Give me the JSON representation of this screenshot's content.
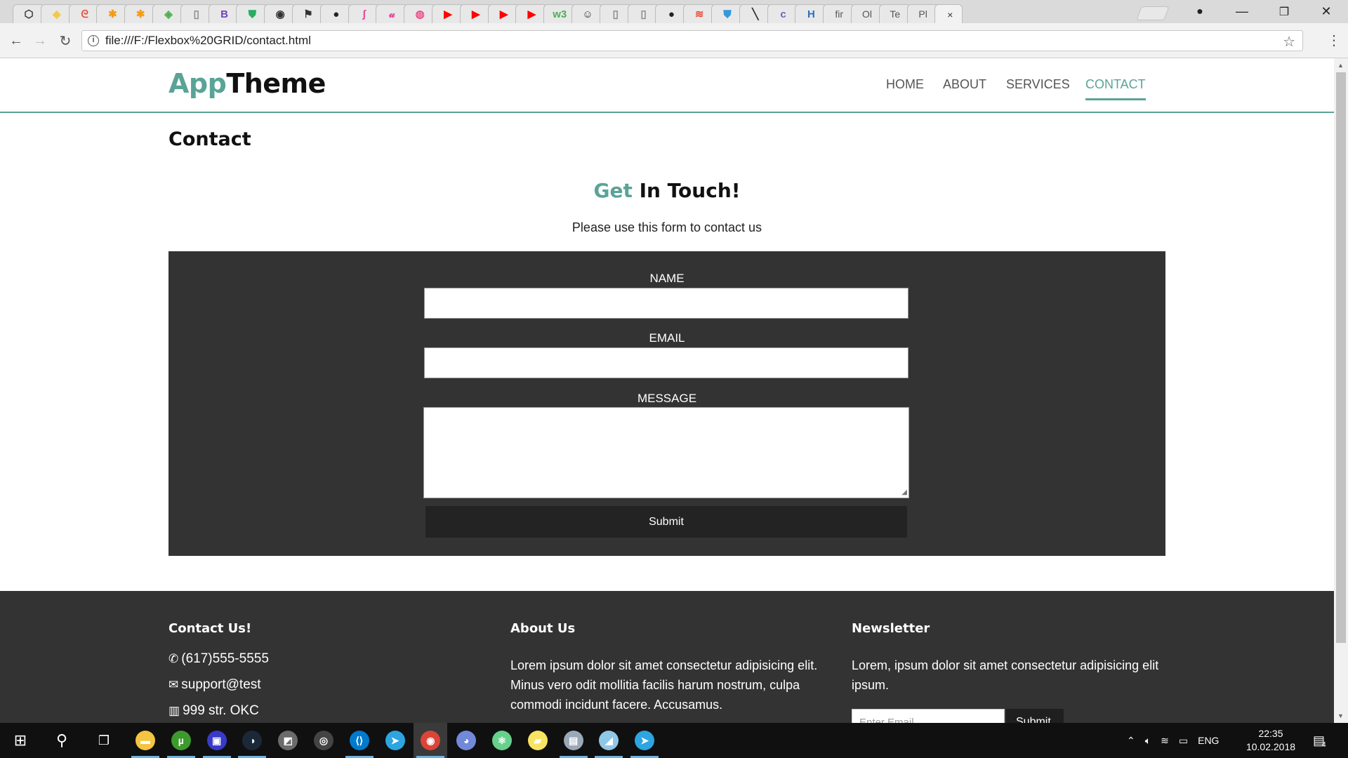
{
  "browser": {
    "tabs": [
      {
        "icon": "codepen-icon",
        "glyph": "⬡",
        "color": "#333333"
      },
      {
        "icon": "sketch-icon",
        "glyph": "◆",
        "color": "#f2c94c"
      },
      {
        "icon": "swirl-icon",
        "glyph": "ᘓ",
        "color": "#e74c3c"
      },
      {
        "icon": "asterisk-icon",
        "glyph": "✱",
        "color": "#f39c12"
      },
      {
        "icon": "asterisk-icon",
        "glyph": "✱",
        "color": "#f39c12"
      },
      {
        "icon": "leaf-icon",
        "glyph": "◈",
        "color": "#4caf50"
      },
      {
        "icon": "file-icon",
        "glyph": "▯",
        "color": "#888888"
      },
      {
        "icon": "bootstrap-icon",
        "glyph": "B",
        "color": "#6f42c1"
      },
      {
        "icon": "shield-icon",
        "glyph": "⛊",
        "color": "#27ae60"
      },
      {
        "icon": "camera-icon",
        "glyph": "◉",
        "color": "#333333"
      },
      {
        "icon": "flag-icon",
        "glyph": "⚑",
        "color": "#333333"
      },
      {
        "icon": "github-icon",
        "glyph": "●",
        "color": "#222222"
      },
      {
        "icon": "script-icon",
        "glyph": "ʃ",
        "color": "#e84393"
      },
      {
        "icon": "brush-icon",
        "glyph": "𝓊",
        "color": "#e84393"
      },
      {
        "icon": "dribbble-icon",
        "glyph": "◍",
        "color": "#ea4c89"
      },
      {
        "icon": "youtube-icon",
        "glyph": "▶",
        "color": "#ff0000"
      },
      {
        "icon": "youtube-icon",
        "glyph": "▶",
        "color": "#ff0000"
      },
      {
        "icon": "youtube-icon",
        "glyph": "▶",
        "color": "#ff0000"
      },
      {
        "icon": "youtube-icon",
        "glyph": "▶",
        "color": "#ff0000"
      },
      {
        "icon": "w3-icon",
        "glyph": "w3",
        "color": "#4caf50"
      },
      {
        "icon": "robot-icon",
        "glyph": "☺",
        "color": "#333333"
      },
      {
        "icon": "file-icon",
        "glyph": "▯",
        "color": "#888888"
      },
      {
        "icon": "file-icon",
        "glyph": "▯",
        "color": "#888888"
      },
      {
        "icon": "github-icon",
        "glyph": "●",
        "color": "#222222"
      },
      {
        "icon": "wifi-icon",
        "glyph": "≋",
        "color": "#e74c3c"
      },
      {
        "icon": "shield-icon",
        "glyph": "⛊",
        "color": "#3498db"
      },
      {
        "icon": "slash-icon",
        "glyph": "╲",
        "color": "#333333"
      },
      {
        "icon": "colorlib-icon",
        "glyph": "c",
        "color": "#7e57c2"
      },
      {
        "icon": "h-icon",
        "glyph": "H",
        "color": "#2c6fbb"
      },
      {
        "icon": "text-tab",
        "glyph": "fir",
        "color": "#555555"
      },
      {
        "icon": "text-tab",
        "glyph": "Ol",
        "color": "#555555"
      },
      {
        "icon": "text-tab",
        "glyph": "Te",
        "color": "#555555"
      },
      {
        "icon": "text-tab",
        "glyph": "Pl",
        "color": "#555555"
      }
    ],
    "active_tab_close": "×",
    "url": "file:///F:/Flexbox%20GRID/contact.html"
  },
  "site": {
    "logo_part1": "App",
    "logo_part2": "Theme",
    "nav": [
      "HOME",
      "ABOUT",
      "SERVICES",
      "CONTACT"
    ],
    "nav_current": "CONTACT",
    "page_title": "Contact",
    "touch_part1": "Get",
    "touch_part2": " In Touch!",
    "lead": "Please use this form to contact us",
    "form": {
      "name_label": "NAME",
      "email_label": "EMAIL",
      "message_label": "MESSAGE",
      "submit": "Submit"
    },
    "footer": {
      "contact_heading": "Contact Us!",
      "phone": "(617)555-5555",
      "email": "support@test",
      "address": "999 str. OKC",
      "about_heading": "About Us",
      "about_text": "Lorem ipsum dolor sit amet consectetur adipisicing elit. Minus vero odit mollitia facilis harum nostrum, culpa commodi incidunt facere. Accusamus.",
      "newsletter_heading": "Newsletter",
      "newsletter_text": "Lorem, ipsum dolor sit amet consectetur adipisicing elit ipsum.",
      "newsletter_placeholder": "Enter Email...",
      "newsletter_submit": "Submit"
    },
    "accent_color": "#5aa397",
    "form_bg": "#333333"
  },
  "taskbar": {
    "apps": [
      {
        "name": "file-explorer-icon",
        "glyph": "▬",
        "color": "#f4c542",
        "open": true
      },
      {
        "name": "utorrent-icon",
        "glyph": "µ",
        "color": "#3d9a2d",
        "open": true
      },
      {
        "name": "floppy-icon",
        "glyph": "▣",
        "color": "#3a3ac9",
        "open": true
      },
      {
        "name": "steam-icon",
        "glyph": "◑",
        "color": "#1b2838",
        "open": true
      },
      {
        "name": "gimp-icon",
        "glyph": "◩",
        "color": "#6b6b6b",
        "open": false
      },
      {
        "name": "eye-icon",
        "glyph": "◎",
        "color": "#444444",
        "open": false
      },
      {
        "name": "vscode-icon",
        "glyph": "⟨⟩",
        "color": "#007acc",
        "open": true
      },
      {
        "name": "telegram-icon",
        "glyph": "➤",
        "color": "#2ca5e0",
        "open": false
      },
      {
        "name": "chrome-icon",
        "glyph": "◉",
        "color": "#db4437",
        "open": true,
        "active": true
      },
      {
        "name": "discord-icon",
        "glyph": "◕",
        "color": "#7289da",
        "open": false
      },
      {
        "name": "atom-icon",
        "glyph": "⚛",
        "color": "#66d18b",
        "open": false
      },
      {
        "name": "sticky-notes-icon",
        "glyph": "▰",
        "color": "#f7e463",
        "open": false
      },
      {
        "name": "photos-icon",
        "glyph": "▤",
        "color": "#9aa9b8",
        "open": true
      },
      {
        "name": "notepad-icon",
        "glyph": "◢",
        "color": "#8fc7e8",
        "open": true
      },
      {
        "name": "telegram-icon",
        "glyph": "➤",
        "color": "#2ca5e0",
        "open": true
      }
    ],
    "lang": "ENG",
    "time": "22:35",
    "date": "10.02.2018",
    "notifications": "4"
  }
}
